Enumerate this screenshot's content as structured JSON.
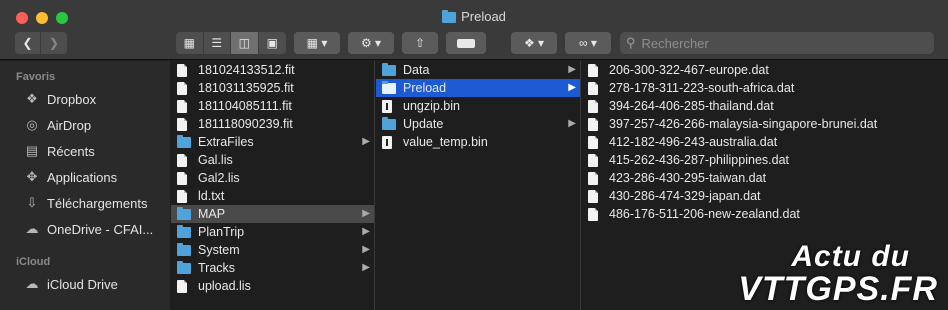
{
  "window": {
    "title": "Preload"
  },
  "toolbar": {
    "back_icon": "chevron-left-icon",
    "forward_icon": "chevron-right-icon",
    "view_modes": [
      "icon-view",
      "list-view",
      "column-view",
      "gallery-view"
    ],
    "active_view": "column-view",
    "group_icon": "group-grid-icon",
    "action_icon": "gear-icon",
    "share_icon": "share-icon",
    "tag_icon": "tag-icon",
    "dropbox_icon": "dropbox-icon",
    "link_icon": "infinity-icon",
    "search_placeholder": "Rechercher"
  },
  "sidebar": {
    "favorites_header": "Favoris",
    "favorites": [
      {
        "label": "Dropbox",
        "icon": "dropbox-icon"
      },
      {
        "label": "AirDrop",
        "icon": "airdrop-icon"
      },
      {
        "label": "Récents",
        "icon": "recents-icon"
      },
      {
        "label": "Applications",
        "icon": "applications-icon"
      },
      {
        "label": "Téléchargements",
        "icon": "downloads-icon"
      },
      {
        "label": "OneDrive - CFAI...",
        "icon": "cloud-icon"
      }
    ],
    "icloud_header": "iCloud",
    "icloud": [
      {
        "label": "iCloud Drive",
        "icon": "icloud-icon"
      }
    ]
  },
  "column1": [
    {
      "name": "181024133512.fit",
      "kind": "file"
    },
    {
      "name": "181031135925.fit",
      "kind": "file"
    },
    {
      "name": "181104085111.fit",
      "kind": "file"
    },
    {
      "name": "181118090239.fit",
      "kind": "file"
    },
    {
      "name": "ExtraFiles",
      "kind": "folder"
    },
    {
      "name": "Gal.lis",
      "kind": "file"
    },
    {
      "name": "Gal2.lis",
      "kind": "file"
    },
    {
      "name": "ld.txt",
      "kind": "file"
    },
    {
      "name": "MAP",
      "kind": "folder",
      "selected": true
    },
    {
      "name": "PlanTrip",
      "kind": "folder"
    },
    {
      "name": "System",
      "kind": "folder"
    },
    {
      "name": "Tracks",
      "kind": "folder"
    },
    {
      "name": "upload.lis",
      "kind": "file"
    }
  ],
  "column2": [
    {
      "name": "Data",
      "kind": "folder"
    },
    {
      "name": "Preload",
      "kind": "folder",
      "selected": true
    },
    {
      "name": "ungzip.bin",
      "kind": "binary"
    },
    {
      "name": "Update",
      "kind": "folder"
    },
    {
      "name": "value_temp.bin",
      "kind": "binary"
    }
  ],
  "column3": [
    {
      "name": "206-300-322-467-europe.dat"
    },
    {
      "name": "278-178-311-223-south-africa.dat"
    },
    {
      "name": "394-264-406-285-thailand.dat"
    },
    {
      "name": "397-257-426-266-malaysia-singapore-brunei.dat"
    },
    {
      "name": "412-182-496-243-australia.dat"
    },
    {
      "name": "415-262-436-287-philippines.dat"
    },
    {
      "name": "423-286-430-295-taiwan.dat"
    },
    {
      "name": "430-286-474-329-japan.dat"
    },
    {
      "name": "486-176-511-206-new-zealand.dat"
    }
  ],
  "watermark": {
    "line1": "Actu du",
    "line2": "VTTGPS.FR"
  },
  "colors": {
    "selection_active": "#1c5bd4",
    "selection_inactive": "#4a4a4a",
    "folder": "#4fa3d8"
  }
}
